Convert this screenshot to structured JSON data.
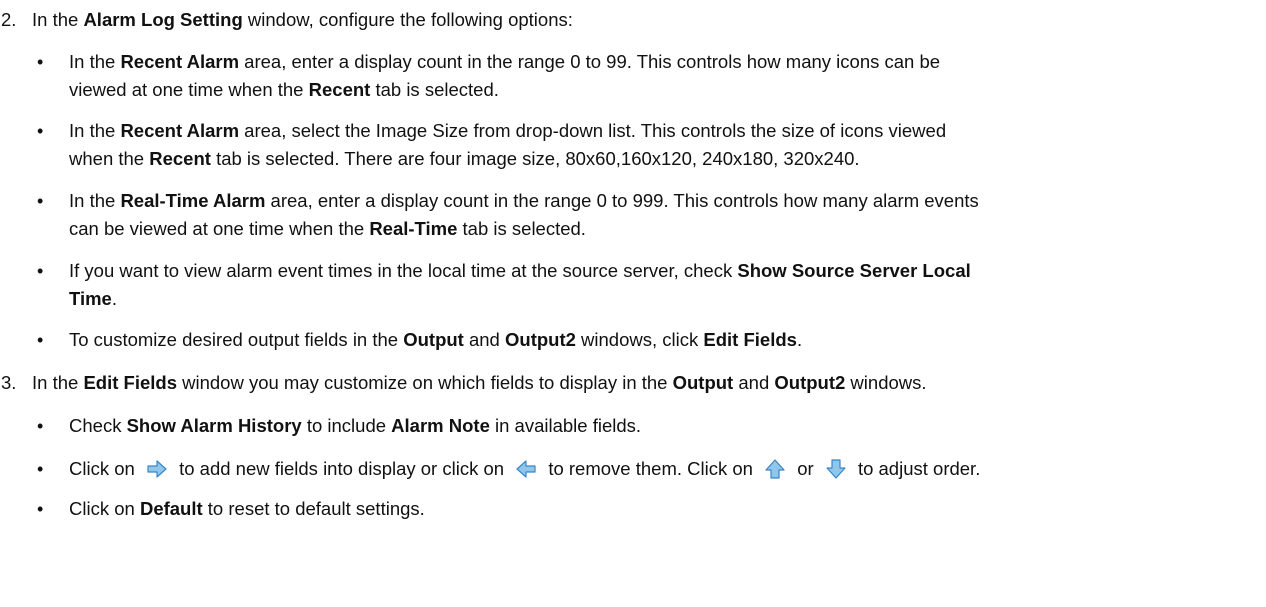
{
  "step2": {
    "num": "2.",
    "t1": "In the ",
    "b1": "Alarm Log Setting",
    "t2": " window, configure the following options:"
  },
  "b1": {
    "l1_t1": "In the ",
    "l1_b1": "Recent Alarm",
    "l1_t2": " area, enter a display count in the range 0 to 99. This controls how many icons can be",
    "l2_t1": "viewed at one time when the ",
    "l2_b1": "Recent",
    "l2_t2": " tab is selected."
  },
  "b2": {
    "l1_t1": "In the ",
    "l1_b1": "Recent Alarm",
    "l1_t2": " area, select the Image Size from drop-down list. This controls the size of icons viewed",
    "l2_t1": "when the ",
    "l2_b1": "Recent",
    "l2_t2": " tab is selected. There are four image size, 80x60,160x120, 240x180, 320x240."
  },
  "b3": {
    "l1_t1": "In the ",
    "l1_b1": "Real-Time Alarm",
    "l1_t2": " area, enter a display count in the range 0 to 999. This controls how many alarm events",
    "l2_t1": "can be viewed at one time when the ",
    "l2_b1": "Real-Time",
    "l2_t2": " tab is selected."
  },
  "b4": {
    "l1_t1": "If you want to view alarm event times in the local time at the source server, check ",
    "l1_b1": "Show Source Server Local",
    "l2_b1": "Time",
    "l2_t2": "."
  },
  "b5": {
    "t1": "To customize desired output fields in the ",
    "b1": "Output",
    "t2": " and ",
    "b2": "Output2",
    "t3": " windows, click ",
    "b3": "Edit Fields",
    "t4": "."
  },
  "step3": {
    "num": "3.",
    "t1": "In the ",
    "b1": "Edit Fields",
    "t2": " window you may customize on which fields to display in the ",
    "b2": "Output",
    "t3": " and ",
    "b3": "Output2",
    "t4": " windows."
  },
  "b6": {
    "t1": "Check ",
    "b1": "Show Alarm History",
    "t2": " to include ",
    "b2": "Alarm Note",
    "t3": " in available fields."
  },
  "b7": {
    "t1": "Click on ",
    "t2": " to add new fields into display or click on ",
    "t3": " to remove them.  Click on ",
    "t4": " or ",
    "t5": " to adjust order."
  },
  "b8": {
    "t1": "Click on ",
    "b1": "Default",
    "t2": " to reset to default settings."
  },
  "bullet_char": "•",
  "icons": {
    "add": "arrow-right-icon",
    "remove": "arrow-left-icon",
    "up": "arrow-up-icon",
    "down": "arrow-down-icon"
  },
  "colors": {
    "icon_fill": "#8ec6ec",
    "icon_stroke": "#3a86c4"
  }
}
